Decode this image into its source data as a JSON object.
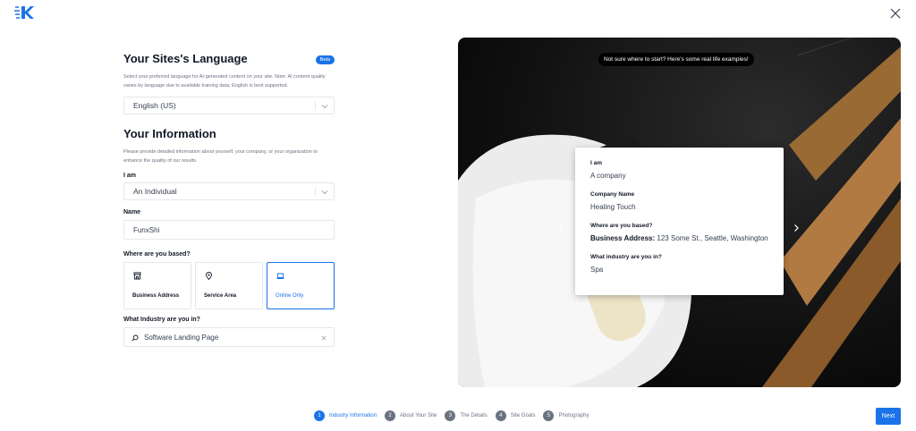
{
  "app": {
    "logo_icon": "brand-logo-icon",
    "close_icon": "close-icon",
    "accent_color": "#1a73e8"
  },
  "language": {
    "title": "Your Sites's Language",
    "badge": "Beta",
    "description": "Select your preferred language for AI-generated content on your site. Note: AI content quality varies by language due to available training data; English is best supported.",
    "selected": "English (US)"
  },
  "information": {
    "title": "Your Information",
    "description": "Please provide detailed information about yourself, your company, or your organization to enhance the quality of our results.",
    "i_am_label": "I am",
    "i_am_value": "An Individual",
    "name_label": "Name",
    "name_value": "FunxShi",
    "based_label": "Where are you based?",
    "based_options": [
      {
        "label": "Business Address",
        "icon": "storefront-icon",
        "selected": false
      },
      {
        "label": "Service Area",
        "icon": "map-pin-icon",
        "selected": false
      },
      {
        "label": "Online Only",
        "icon": "laptop-icon",
        "selected": true
      }
    ],
    "industry_label": "What Industry are you in?",
    "industry_value": "Software Landing Page"
  },
  "example": {
    "hint": "Not sure where to start? Here's some real life examples!",
    "q1": "I am",
    "a1": "A company",
    "q2": "Company Name",
    "a2": "Healing Touch",
    "q3": "Where are you based?",
    "a3_label": "Business Address:",
    "a3_value": "123 Some St., Seattle, Washington",
    "q4": "What industry are you in?",
    "a4": "Spa"
  },
  "stepper": {
    "steps": [
      {
        "num": "1",
        "label": "Industry Information",
        "active": true
      },
      {
        "num": "2",
        "label": "About Your Site",
        "active": false
      },
      {
        "num": "3",
        "label": "The Details",
        "active": false
      },
      {
        "num": "4",
        "label": "Site Goals",
        "active": false
      },
      {
        "num": "5",
        "label": "Photography",
        "active": false
      }
    ]
  },
  "footer": {
    "next_label": "Next"
  }
}
